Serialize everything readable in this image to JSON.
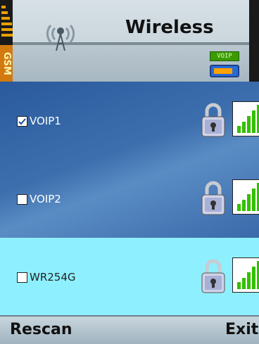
{
  "header": {
    "title": "Wireless",
    "network_label": "GSM",
    "voip_badge": "VOIP"
  },
  "networks": [
    {
      "name": "VOIP1",
      "checked": true
    },
    {
      "name": "VOIP2",
      "checked": false
    },
    {
      "name": "WR254G",
      "checked": false
    }
  ],
  "softkeys": {
    "left": "Rescan",
    "right": "Exit"
  },
  "colors": {
    "list_bg": "#2f5e9e",
    "selected_row": "#8ef0ff",
    "signal_green": "#33c000",
    "accent_orange": "#d27a10"
  }
}
